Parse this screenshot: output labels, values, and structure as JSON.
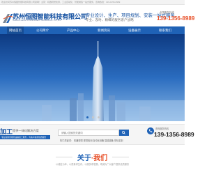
{
  "topbar": {
    "text": "欢迎访问苏州恒图智能科技有限公司官网！主营：机器视觉检测，工业自动化，智能制造一站式服务，咨询热线：139-1356-8989"
  },
  "header": {
    "company_name": "苏州恒图智能科技有限公司",
    "company_en": "SUZHOU HENGTU INTELLIGENT TECHNOLOGY CO.,LTD",
    "slogan": "专业设计、生产、项目规划、安装一站式服务",
    "slogan_sub": "专业、及时、精细的服务客户战略",
    "hotline_label": "全国服务热线",
    "hotline_number": "139-1356-8989"
  },
  "nav": {
    "items": [
      "网站首页",
      "公司简介",
      "产品中心",
      "新闻资讯",
      "设备展示",
      "联系我们"
    ]
  },
  "search_strip": {
    "title_main": "加工",
    "title_sub": "提供一体化解决方案",
    "desc": "专业提供智能化设备加工服务，为客户提供优质服务",
    "search_placeholder": "请输入搜索的关键词",
    "hot_label": "热门关键词： 机器视觉   视觉检测   自动化设备   智能装备   非标定制",
    "consult_label": "咨询服务热线",
    "consult_number": "139-1356-8989"
  },
  "about": {
    "title_left": "关于",
    "title_dot": "·",
    "title_right": "我们",
    "subtitle": "以诚信为本，以质量求生存，以服务求发展，竭诚为广大客户提供优质服务"
  },
  "colors": {
    "brand_blue": "#1f62b6",
    "accent_orange": "#e8512a"
  }
}
